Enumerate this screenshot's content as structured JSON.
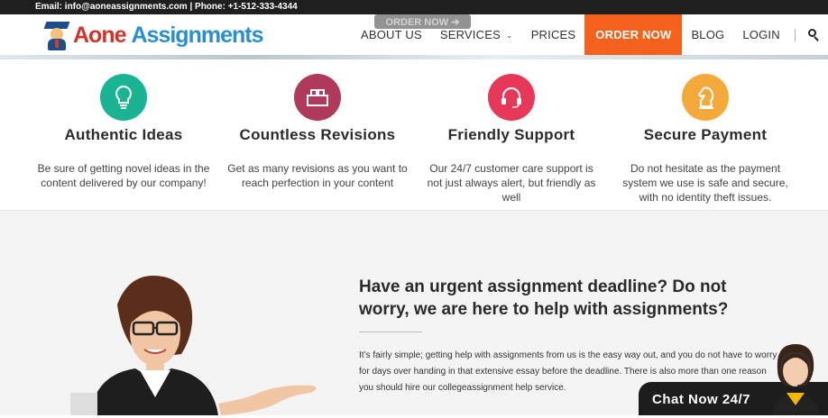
{
  "topbar": {
    "contact": "Email: info@aoneassignments.com | Phone: +1-512-333-4344"
  },
  "header": {
    "logo_part1": "Aone",
    "logo_part2": "Assignments",
    "ghost_button": "ORDER NOW ➔",
    "nav": [
      {
        "label": "ABOUT US"
      },
      {
        "label": "SERVICES",
        "chevron": "⌄"
      },
      {
        "label": "PRICES"
      },
      {
        "label": "ORDER NOW"
      },
      {
        "label": "BLOG"
      },
      {
        "label": "LOGIN"
      }
    ]
  },
  "features": [
    {
      "icon": "lightbulb-icon",
      "color": "#1ab394",
      "title": "Authentic Ideas",
      "desc": "Be sure of getting novel ideas in the content delivered by our company!"
    },
    {
      "icon": "blocks-icon",
      "color": "#b03a5b",
      "title": "Countless Revisions",
      "desc": "Get as many revisions as you want to reach perfection in your content"
    },
    {
      "icon": "headset-icon",
      "color": "#e8385a",
      "title": "Friendly Support",
      "desc": "Our 24/7 customer care support is not just always alert, but friendly as well"
    },
    {
      "icon": "chess-knight-icon",
      "color": "#f4a93a",
      "title": "Secure Payment",
      "desc": "Do not hesitate as the payment system we use is safe and secure, with no identity theft issues."
    }
  ],
  "help_section": {
    "headline": "Have an urgent assignment deadline? Do not worry, we are here to help with assignments?",
    "paragraph": "It’s fairly simple; getting help with assignments from us is the easy way out, and you do not have to worry for days over handing in that extensive essay before the deadline. There is also more than one reason you should hire our collegeassignment help service."
  },
  "chat": {
    "label": "Chat Now 24/7"
  }
}
